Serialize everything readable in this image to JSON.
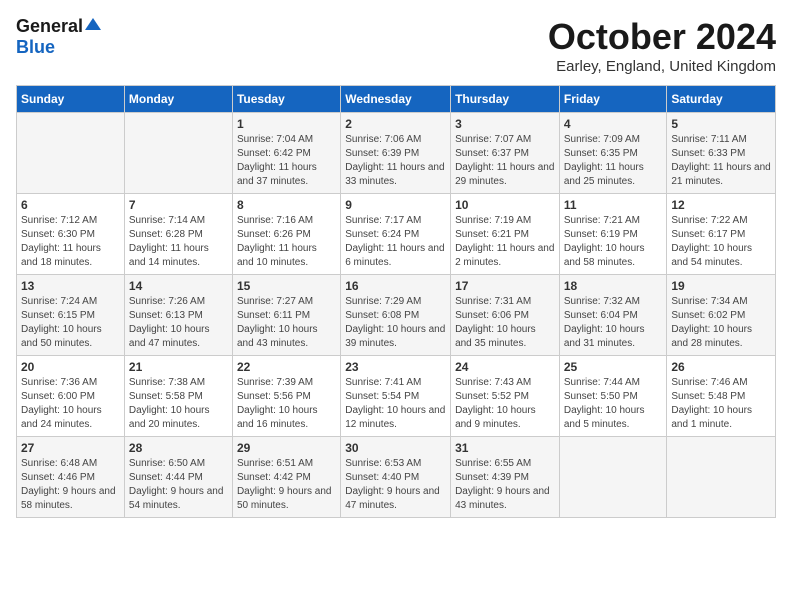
{
  "logo": {
    "general": "General",
    "blue": "Blue"
  },
  "title": "October 2024",
  "location": "Earley, England, United Kingdom",
  "days_of_week": [
    "Sunday",
    "Monday",
    "Tuesday",
    "Wednesday",
    "Thursday",
    "Friday",
    "Saturday"
  ],
  "weeks": [
    [
      {
        "day": "",
        "detail": ""
      },
      {
        "day": "",
        "detail": ""
      },
      {
        "day": "1",
        "detail": "Sunrise: 7:04 AM\nSunset: 6:42 PM\nDaylight: 11 hours and 37 minutes."
      },
      {
        "day": "2",
        "detail": "Sunrise: 7:06 AM\nSunset: 6:39 PM\nDaylight: 11 hours and 33 minutes."
      },
      {
        "day": "3",
        "detail": "Sunrise: 7:07 AM\nSunset: 6:37 PM\nDaylight: 11 hours and 29 minutes."
      },
      {
        "day": "4",
        "detail": "Sunrise: 7:09 AM\nSunset: 6:35 PM\nDaylight: 11 hours and 25 minutes."
      },
      {
        "day": "5",
        "detail": "Sunrise: 7:11 AM\nSunset: 6:33 PM\nDaylight: 11 hours and 21 minutes."
      }
    ],
    [
      {
        "day": "6",
        "detail": "Sunrise: 7:12 AM\nSunset: 6:30 PM\nDaylight: 11 hours and 18 minutes."
      },
      {
        "day": "7",
        "detail": "Sunrise: 7:14 AM\nSunset: 6:28 PM\nDaylight: 11 hours and 14 minutes."
      },
      {
        "day": "8",
        "detail": "Sunrise: 7:16 AM\nSunset: 6:26 PM\nDaylight: 11 hours and 10 minutes."
      },
      {
        "day": "9",
        "detail": "Sunrise: 7:17 AM\nSunset: 6:24 PM\nDaylight: 11 hours and 6 minutes."
      },
      {
        "day": "10",
        "detail": "Sunrise: 7:19 AM\nSunset: 6:21 PM\nDaylight: 11 hours and 2 minutes."
      },
      {
        "day": "11",
        "detail": "Sunrise: 7:21 AM\nSunset: 6:19 PM\nDaylight: 10 hours and 58 minutes."
      },
      {
        "day": "12",
        "detail": "Sunrise: 7:22 AM\nSunset: 6:17 PM\nDaylight: 10 hours and 54 minutes."
      }
    ],
    [
      {
        "day": "13",
        "detail": "Sunrise: 7:24 AM\nSunset: 6:15 PM\nDaylight: 10 hours and 50 minutes."
      },
      {
        "day": "14",
        "detail": "Sunrise: 7:26 AM\nSunset: 6:13 PM\nDaylight: 10 hours and 47 minutes."
      },
      {
        "day": "15",
        "detail": "Sunrise: 7:27 AM\nSunset: 6:11 PM\nDaylight: 10 hours and 43 minutes."
      },
      {
        "day": "16",
        "detail": "Sunrise: 7:29 AM\nSunset: 6:08 PM\nDaylight: 10 hours and 39 minutes."
      },
      {
        "day": "17",
        "detail": "Sunrise: 7:31 AM\nSunset: 6:06 PM\nDaylight: 10 hours and 35 minutes."
      },
      {
        "day": "18",
        "detail": "Sunrise: 7:32 AM\nSunset: 6:04 PM\nDaylight: 10 hours and 31 minutes."
      },
      {
        "day": "19",
        "detail": "Sunrise: 7:34 AM\nSunset: 6:02 PM\nDaylight: 10 hours and 28 minutes."
      }
    ],
    [
      {
        "day": "20",
        "detail": "Sunrise: 7:36 AM\nSunset: 6:00 PM\nDaylight: 10 hours and 24 minutes."
      },
      {
        "day": "21",
        "detail": "Sunrise: 7:38 AM\nSunset: 5:58 PM\nDaylight: 10 hours and 20 minutes."
      },
      {
        "day": "22",
        "detail": "Sunrise: 7:39 AM\nSunset: 5:56 PM\nDaylight: 10 hours and 16 minutes."
      },
      {
        "day": "23",
        "detail": "Sunrise: 7:41 AM\nSunset: 5:54 PM\nDaylight: 10 hours and 12 minutes."
      },
      {
        "day": "24",
        "detail": "Sunrise: 7:43 AM\nSunset: 5:52 PM\nDaylight: 10 hours and 9 minutes."
      },
      {
        "day": "25",
        "detail": "Sunrise: 7:44 AM\nSunset: 5:50 PM\nDaylight: 10 hours and 5 minutes."
      },
      {
        "day": "26",
        "detail": "Sunrise: 7:46 AM\nSunset: 5:48 PM\nDaylight: 10 hours and 1 minute."
      }
    ],
    [
      {
        "day": "27",
        "detail": "Sunrise: 6:48 AM\nSunset: 4:46 PM\nDaylight: 9 hours and 58 minutes."
      },
      {
        "day": "28",
        "detail": "Sunrise: 6:50 AM\nSunset: 4:44 PM\nDaylight: 9 hours and 54 minutes."
      },
      {
        "day": "29",
        "detail": "Sunrise: 6:51 AM\nSunset: 4:42 PM\nDaylight: 9 hours and 50 minutes."
      },
      {
        "day": "30",
        "detail": "Sunrise: 6:53 AM\nSunset: 4:40 PM\nDaylight: 9 hours and 47 minutes."
      },
      {
        "day": "31",
        "detail": "Sunrise: 6:55 AM\nSunset: 4:39 PM\nDaylight: 9 hours and 43 minutes."
      },
      {
        "day": "",
        "detail": ""
      },
      {
        "day": "",
        "detail": ""
      }
    ]
  ]
}
